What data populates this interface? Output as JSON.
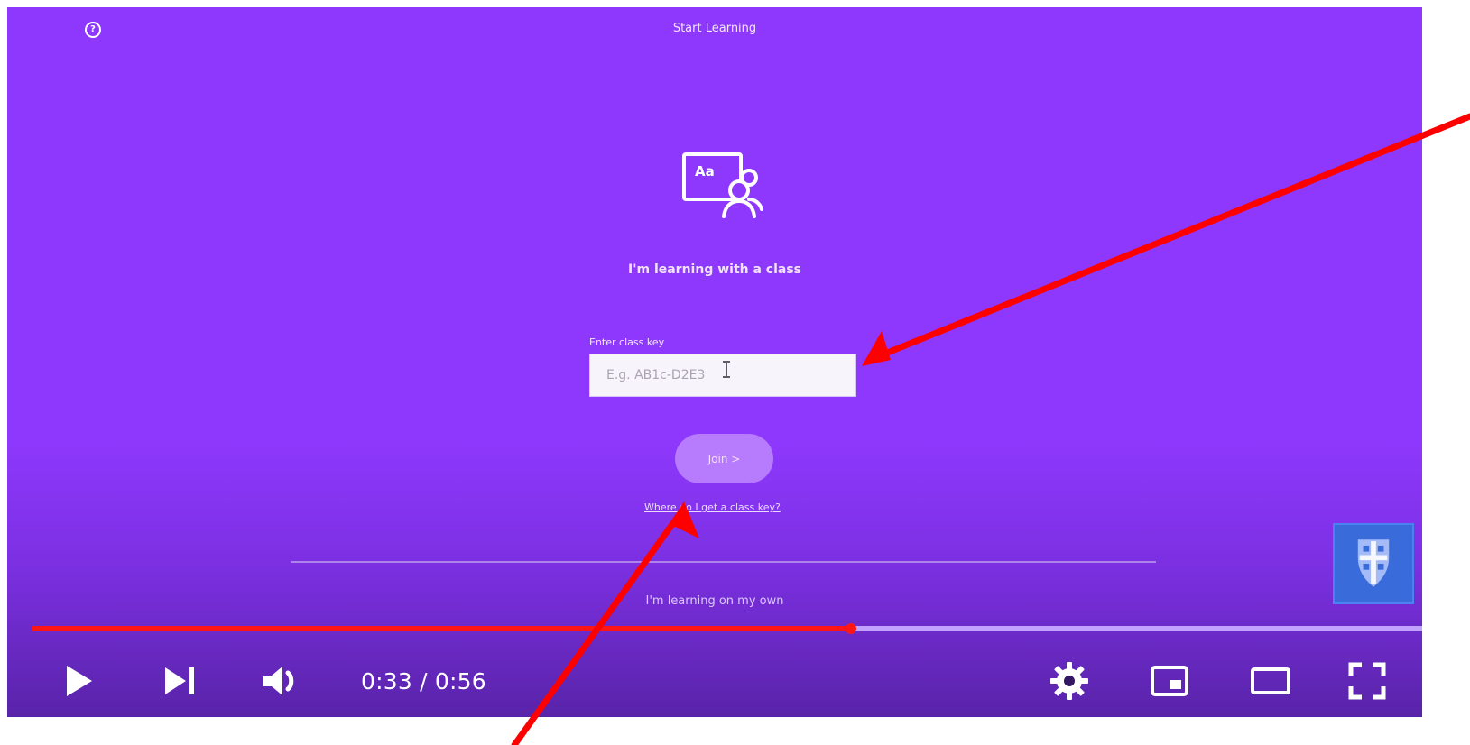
{
  "app": {
    "title": "Start Learning"
  },
  "class_section": {
    "heading": "I'm learning with a class",
    "input_label": "Enter class key",
    "input_placeholder": "E.g. AB1c-D2E3",
    "join_label": "Join >",
    "help_link": "Where do I get a class key?",
    "own_link": "I'm learning on my own"
  },
  "player": {
    "current_time": "0:33",
    "duration": "0:56",
    "time_display": "0:33 / 0:56",
    "progress": 0.589
  },
  "icons": {
    "help": "help-circle-icon",
    "class": "classroom-icon",
    "play": "play-icon",
    "next": "next-icon",
    "volume": "volume-icon",
    "settings": "settings-gear-icon",
    "miniplayer": "miniplayer-icon",
    "theater": "theater-mode-icon",
    "fullscreen": "fullscreen-icon",
    "channel_logo": "channel-crest-icon"
  },
  "colors": {
    "background": "#8e38fd",
    "accent": "#ff1717",
    "button": "#b77bfd",
    "logo": "#3a6bda"
  }
}
